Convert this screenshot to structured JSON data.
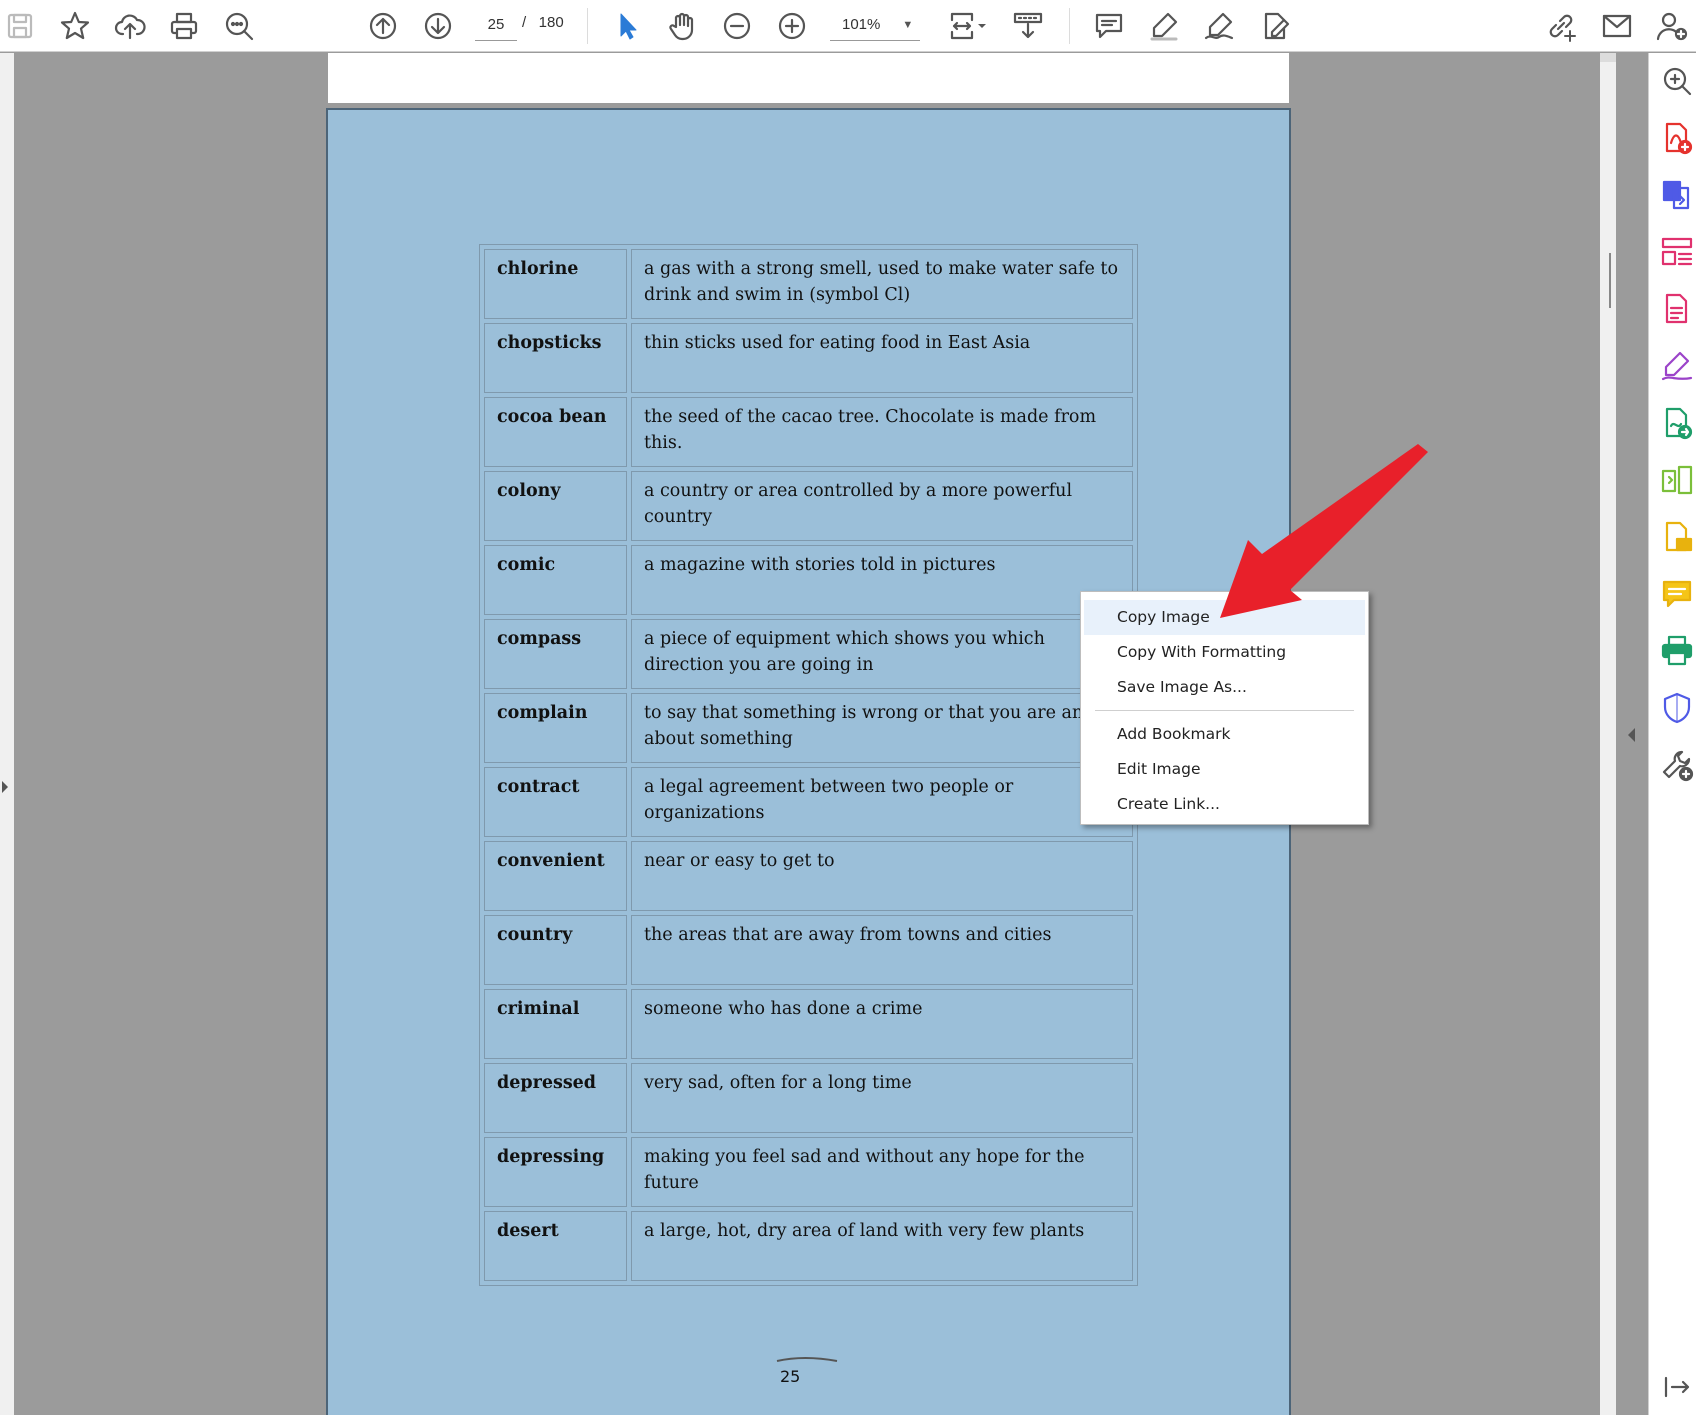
{
  "toolbar": {
    "current_page": "25",
    "page_total": "/   180",
    "zoom": "101%",
    "left_tools": [
      "save-icon",
      "bookmark-star-icon",
      "cloud-upload-icon",
      "print-icon",
      "find-zoom-icon"
    ],
    "nav_tools": [
      "page-up-icon",
      "page-down-icon"
    ],
    "view_tools": [
      "select-cursor-icon",
      "hand-tool-icon",
      "zoom-out-icon",
      "zoom-in-icon"
    ],
    "right_tools": [
      "share-link-icon",
      "email-icon",
      "add-user-icon"
    ]
  },
  "document": {
    "entries": [
      {
        "term": "chlorine",
        "definition": "a gas with a strong smell, used to make water safe to drink and swim in (symbol Cl)"
      },
      {
        "term": "chopsticks",
        "definition": "thin sticks used for eating food in East Asia"
      },
      {
        "term": "cocoa bean",
        "definition": "the seed of the cacao tree. Chocolate is made from this."
      },
      {
        "term": "colony",
        "definition": "a country or area controlled by a more powerful country"
      },
      {
        "term": "comic",
        "definition": "a magazine with stories told in pictures"
      },
      {
        "term": "compass",
        "definition": "a piece of equipment which shows you which direction you are going in"
      },
      {
        "term": "complain",
        "definition": "to say that something is wrong or that you are angry about something"
      },
      {
        "term": "contract",
        "definition": "a legal agreement between two people or organizations"
      },
      {
        "term": "convenient",
        "definition": "near or easy to get to"
      },
      {
        "term": "country",
        "definition": "the areas that are away from towns and cities"
      },
      {
        "term": "criminal",
        "definition": "someone who has done a crime"
      },
      {
        "term": "depressed",
        "definition": "very sad, often for a long time"
      },
      {
        "term": "depressing",
        "definition": "making you feel sad and without any hope for the future"
      },
      {
        "term": "desert",
        "definition": "a large, hot, dry area of land with very few plants"
      }
    ],
    "page_number": "25"
  },
  "context_menu": {
    "items": [
      "Copy Image",
      "Copy With Formatting",
      "Save Image As...",
      "Add Bookmark",
      "Edit Image",
      "Create Link..."
    ]
  },
  "colors": {
    "page_background": "#9bbfd9",
    "arrow": "#e8202a",
    "menu_highlight": "#e8f1fb"
  }
}
